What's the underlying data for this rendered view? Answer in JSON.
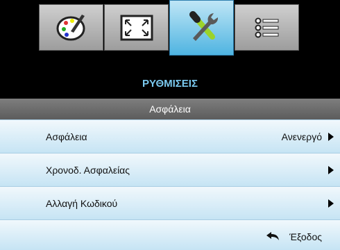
{
  "tabs": [
    {
      "icon": "palette-icon",
      "active": false
    },
    {
      "icon": "fullscreen-icon",
      "active": false
    },
    {
      "icon": "tools-icon",
      "active": true
    },
    {
      "icon": "list-icon",
      "active": false
    }
  ],
  "menu": {
    "title": "ΡΥΘΜΙΣΕΙΣ",
    "section": "Ασφάλεια",
    "items": [
      {
        "label": "Ασφάλεια",
        "value": "Ανενεργό"
      },
      {
        "label": "Χρονοδ. Ασφαλείας",
        "value": ""
      },
      {
        "label": "Αλλαγή Κωδικού",
        "value": ""
      }
    ],
    "exit_label": "Έξοδος"
  },
  "colors": {
    "title": "#7bc9ef",
    "active_tab": "#4fb4e1",
    "row": "#d6ecf8",
    "subheader": "#6c6c6c"
  }
}
